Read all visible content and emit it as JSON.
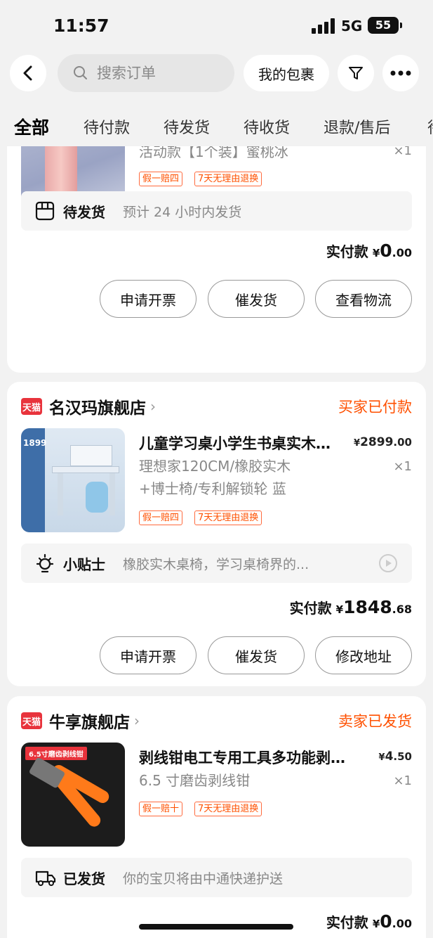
{
  "status_bar": {
    "time": "11:57",
    "network": "5G",
    "battery": "55"
  },
  "header": {
    "search_placeholder": "搜索订单",
    "my_package_label": "我的包裹",
    "icons": [
      "back-icon",
      "search-icon",
      "filter-icon",
      "more-icon"
    ]
  },
  "tabs": [
    {
      "label": "全部",
      "active": true
    },
    {
      "label": "待付款",
      "active": false
    },
    {
      "label": "待发货",
      "active": false
    },
    {
      "label": "待收货",
      "active": false
    },
    {
      "label": "退款/售后",
      "active": false
    },
    {
      "label": "待",
      "active": false
    }
  ],
  "orders": [
    {
      "product": {
        "spec": "活动款【1个装】蜜桃冰",
        "qty": "×1"
      },
      "tags": [
        "假一赔四",
        "7天无理由退换"
      ],
      "info": {
        "label": "待发货",
        "desc": "预计 24 小时内发货",
        "icon": "package-icon"
      },
      "paid_label": "实付款",
      "currency": "¥",
      "paid_int": "0",
      "paid_dec": ".00",
      "actions": [
        "申请开票",
        "催发货",
        "查看物流"
      ]
    },
    {
      "shop_badge": "天猫",
      "shop_name": "名汉玛旗舰店",
      "status": "买家已付款",
      "product": {
        "title": "儿童学习桌小学生书桌实木书桌",
        "price_int": "2899",
        "price_dec": ".00",
        "spec_line1": "理想家120CM/橡胶实木",
        "spec_line2": "+博士椅/专利解锁轮 蓝",
        "qty": "×1",
        "thumb_price": "1899"
      },
      "tags": [
        "假一赔四",
        "7天无理由退换"
      ],
      "info": {
        "label": "小贴士",
        "desc": "橡胶实木桌椅，学习桌椅界的...",
        "icon": "lightbulb-icon"
      },
      "paid_label": "实付款",
      "currency": "¥",
      "paid_int": "1848",
      "paid_dec": ".68",
      "actions": [
        "申请开票",
        "催发货",
        "修改地址"
      ]
    },
    {
      "shop_badge": "天猫",
      "shop_name": "牛享旗舰店",
      "status": "卖家已发货",
      "product": {
        "title": "剥线钳电工专用工具多功能剥线钳",
        "price_int": "4",
        "price_dec": ".50",
        "spec_line1": "6.5 寸磨齿剥线钳",
        "qty": "×1",
        "thumb_label": "6.5寸磨齿剥线钳"
      },
      "tags": [
        "假一赔十",
        "7天无理由退换"
      ],
      "info": {
        "label": "已发货",
        "desc": "你的宝贝将由中通快递护送",
        "icon": "truck-icon"
      },
      "paid_label": "实付款",
      "currency": "¥",
      "paid_int": "0",
      "paid_dec": ".00"
    }
  ],
  "colors": {
    "accent": "#ff5000",
    "tmall_red": "#e8333c",
    "background": "#f2f2f2"
  }
}
